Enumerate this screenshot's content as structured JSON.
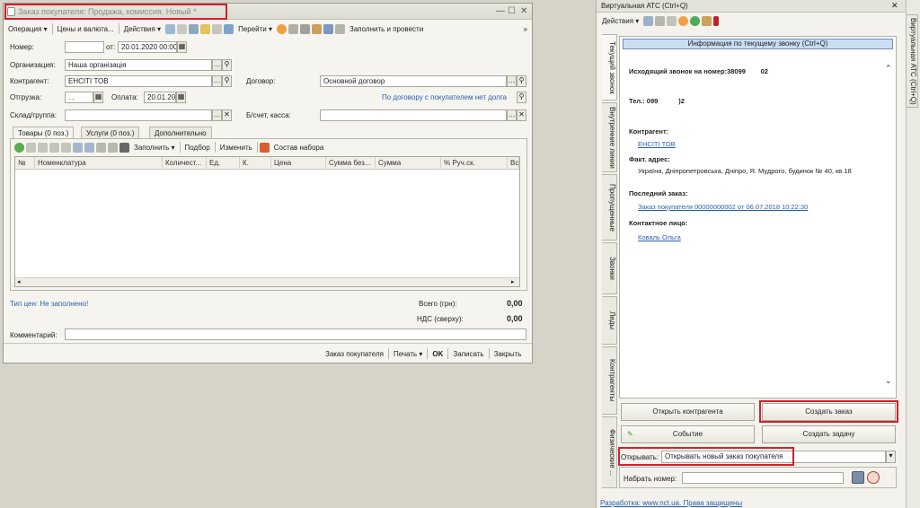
{
  "order_window": {
    "title": "Заказ покупателя: Продажа, комиссия. Новый *",
    "window_controls": [
      "—",
      "☐",
      "✕"
    ],
    "toolbar": {
      "operation": "Операция ▾",
      "prices": "Цены и валюта...",
      "actions": "Действия ▾",
      "goto": "Перейти ▾",
      "fill_and_post": "Заполнить и провести"
    },
    "fields": {
      "number_label": "Номер:",
      "number_value": "",
      "from_label": "от:",
      "date_value": "20.01.2020 00:00",
      "org_label": "Организация:",
      "org_value": "Наша організація",
      "counterparty_label": "Контрагент:",
      "counterparty_value": "ЕНСІТІ ТОВ",
      "contract_label": "Договор:",
      "contract_value": "Основной договор",
      "shipment_label": "Отгрузка:",
      "shipment_value": ". .",
      "payment_label": "Оплата:",
      "payment_value": "20.01.20",
      "contract_debt": "По договору с покупателем нет долга",
      "warehouse_label": "Склад/группа:",
      "account_label": "Б/счет, касса:"
    },
    "tabs": [
      "Товары (0 поз.)",
      "Услуги (0 поз.)",
      "Дополнительно"
    ],
    "tab_toolbar": {
      "fill": "Заполнить ▾",
      "pick": "Подбор",
      "change": "Изменить",
      "set_composition": "Состав набора"
    },
    "columns": [
      "№",
      "Номенклатура",
      "Количест...",
      "Ед.",
      "К.",
      "Цена",
      "Сумма без...",
      "Сумма",
      "% Руч.ск.",
      "Все"
    ],
    "price_type": "Тип цен: Не заполнено!",
    "total_label": "Всего (грн):",
    "total_value": "0,00",
    "vat_label": "НДС (сверху):",
    "vat_value": "0,00",
    "comment_label": "Комментарий:",
    "comment_value": "",
    "footer": {
      "doc": "Заказ покупателя",
      "print": "Печать ▾",
      "ok": "OK",
      "save": "Записать",
      "close": "Закрыть"
    }
  },
  "atc_panel": {
    "title": "Виртуальная АТС (Ctrl+Q)",
    "actions": "Действия ▾",
    "close": "✕",
    "info_header": "Информация по текущему звонку (Ctrl+Q)",
    "call_line": "Исходящий звонок на номер:38099        02",
    "phone_line": "Тел.: 099           )2",
    "counterparty_label": "Контрагент:",
    "counterparty_link": "ЕНСІТІ ТОВ",
    "address_label": "Факт. адрес:",
    "address_value": "Україна, Дніпропетровська, Дніпро, Я. Мудрого, будинок № 40, кв.18",
    "last_order_label": "Последний заказ:",
    "last_order_link": "Заказ покупателя 00000000002 от 06.07.2018 10:22:30",
    "contact_label": "Контактное лицо:",
    "contact_link": "Коваль Ольга",
    "buttons": {
      "open_counterparty": "Открыть контрагента",
      "create_order": "Создать заказ",
      "event": "Событие",
      "create_task": "Создать задачу"
    },
    "open_label": "Открывать:",
    "open_value": "Открывать новый заказ покупателя",
    "dial_label": "Набрать номер:",
    "dial_value": "",
    "footer_link": "Разработка: www.nct.ua. Права защищены",
    "side_tabs": [
      "Текущий звонок",
      "Внутренние линии",
      "Пропущенные",
      "Звонки",
      "Лиды",
      "Контрагенты",
      "Физические ..."
    ],
    "right_tab": "Виртуальная АТС (Ctrl+Q)"
  },
  "colors": {
    "highlight": "#d1202b",
    "link": "#2a5fb0",
    "header_blue": "#c9ddf5"
  }
}
